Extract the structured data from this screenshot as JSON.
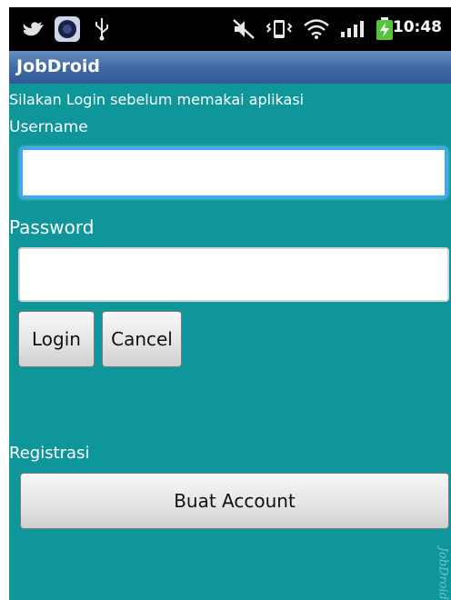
{
  "status_bar": {
    "time": "10:48",
    "icons": [
      "twitter-bird-icon",
      "camera-icon",
      "usb-icon",
      "mute-icon",
      "vibrate-icon",
      "wifi-icon",
      "signal-icon",
      "battery-charging-icon"
    ],
    "colors": {
      "battery": "#56c33a"
    }
  },
  "app": {
    "title": "JobDroid"
  },
  "login": {
    "instruction": "Silakan Login sebelum memakai aplikasi",
    "username_label": "Username",
    "username_value": "",
    "password_label": "Password",
    "password_value": "",
    "login_button": "Login",
    "cancel_button": "Cancel"
  },
  "registration": {
    "label": "Registrasi",
    "create_account_button": "Buat Account"
  },
  "watermark": "JobDroid",
  "colors": {
    "background": "#0f969a",
    "titlebar": "#3f6aa4",
    "focus_ring": "#3aa8ff"
  }
}
